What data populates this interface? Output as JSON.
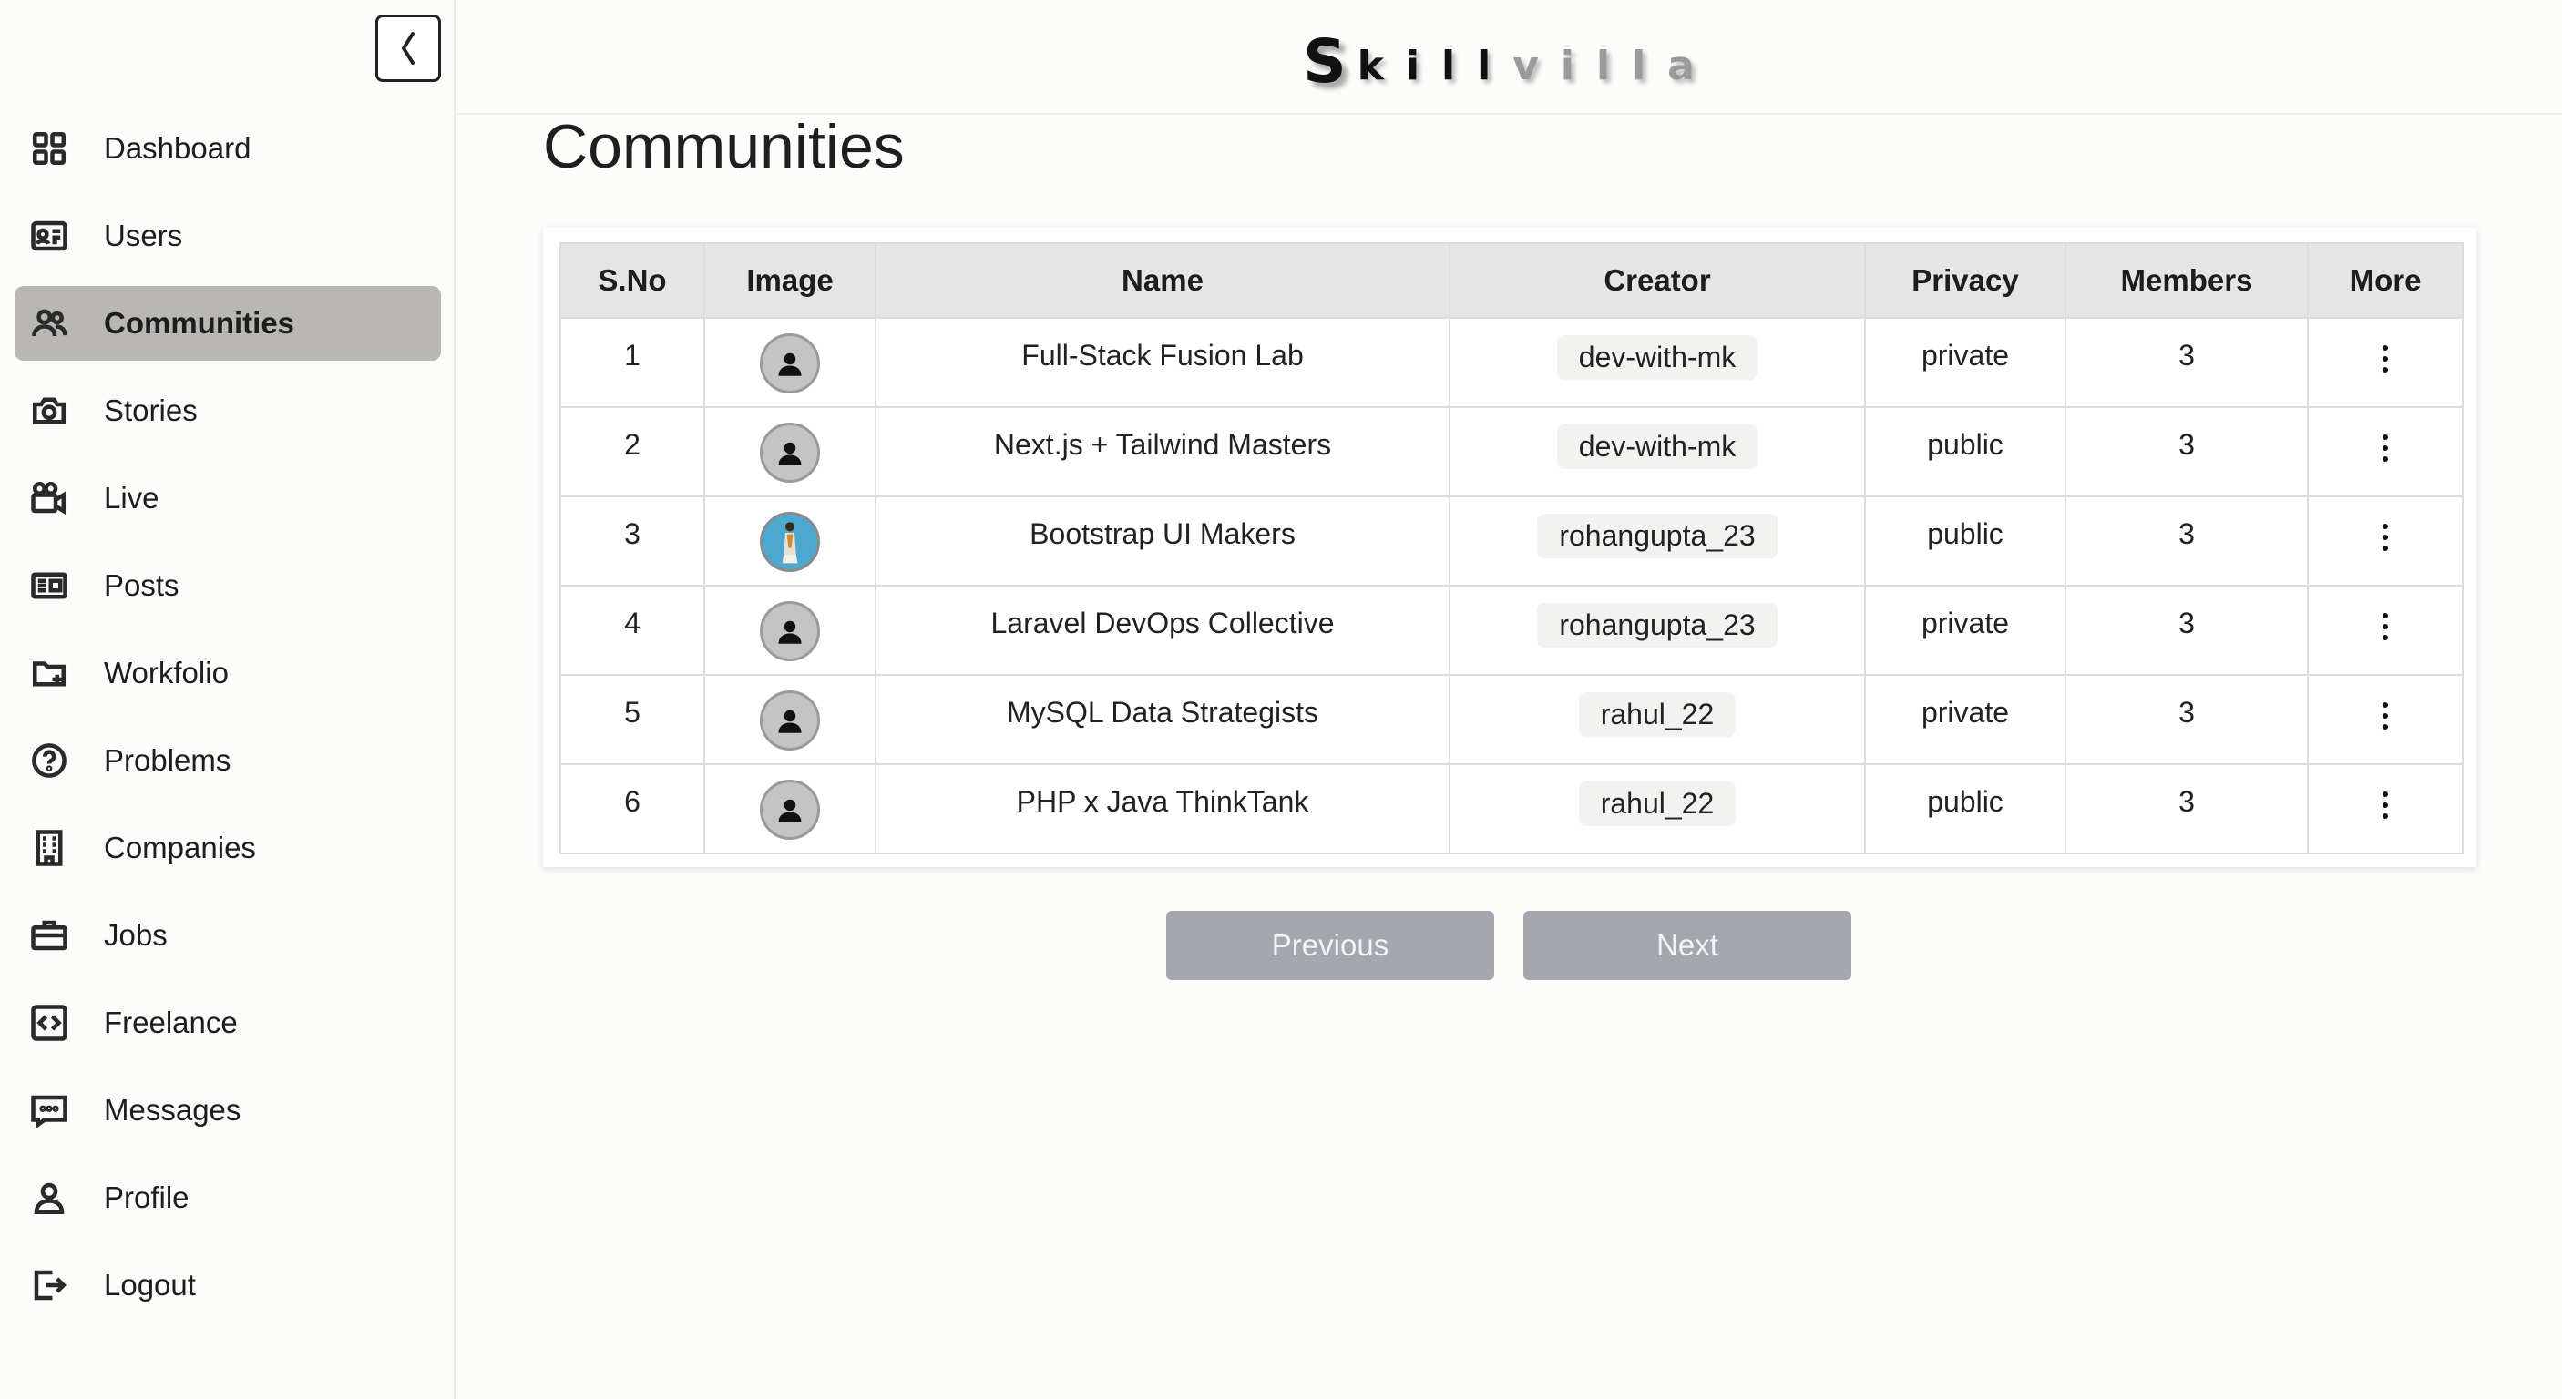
{
  "brand": {
    "first": "S",
    "dark": "kill",
    "light": "villa"
  },
  "sidebar": {
    "items": [
      {
        "label": "Dashboard",
        "icon": "grid-icon"
      },
      {
        "label": "Users",
        "icon": "id-card-icon"
      },
      {
        "label": "Communities",
        "icon": "users-icon",
        "active": true
      },
      {
        "label": "Stories",
        "icon": "camera-icon"
      },
      {
        "label": "Live",
        "icon": "video-camera-icon"
      },
      {
        "label": "Posts",
        "icon": "newspaper-icon"
      },
      {
        "label": "Workfolio",
        "icon": "folder-plus-icon"
      },
      {
        "label": "Problems",
        "icon": "question-circle-icon"
      },
      {
        "label": "Companies",
        "icon": "building-icon"
      },
      {
        "label": "Jobs",
        "icon": "briefcase-icon"
      },
      {
        "label": "Freelance",
        "icon": "code-icon"
      },
      {
        "label": "Messages",
        "icon": "message-icon"
      },
      {
        "label": "Profile",
        "icon": "person-icon"
      },
      {
        "label": "Logout",
        "icon": "logout-icon"
      }
    ]
  },
  "page": {
    "title": "Communities"
  },
  "table": {
    "headers": [
      "S.No",
      "Image",
      "Name",
      "Creator",
      "Privacy",
      "Members",
      "More"
    ],
    "rows": [
      {
        "sno": "1",
        "image": "default",
        "name": "Full-Stack Fusion Lab",
        "creator": "dev-with-mk",
        "privacy": "private",
        "members": "3"
      },
      {
        "sno": "2",
        "image": "default",
        "name": "Next.js + Tailwind Masters",
        "creator": "dev-with-mk",
        "privacy": "public",
        "members": "3"
      },
      {
        "sno": "3",
        "image": "photo",
        "name": "Bootstrap UI Makers",
        "creator": "rohangupta_23",
        "privacy": "public",
        "members": "3"
      },
      {
        "sno": "4",
        "image": "default",
        "name": "Laravel DevOps Collective",
        "creator": "rohangupta_23",
        "privacy": "private",
        "members": "3"
      },
      {
        "sno": "5",
        "image": "default",
        "name": "MySQL Data Strategists",
        "creator": "rahul_22",
        "privacy": "private",
        "members": "3"
      },
      {
        "sno": "6",
        "image": "default",
        "name": "PHP x Java ThinkTank",
        "creator": "rahul_22",
        "privacy": "public",
        "members": "3"
      }
    ]
  },
  "pagination": {
    "previous": "Previous",
    "next": "Next"
  },
  "colors": {
    "active_nav": "#b8b7b4",
    "pager_button": "#a4a7ad",
    "header_bg": "#e5e5e5"
  }
}
